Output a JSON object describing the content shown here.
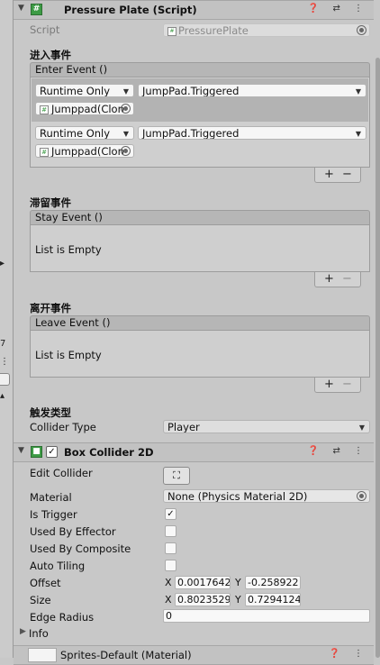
{
  "left_strip": {
    "mark_1": "▸",
    "mark_2": "7",
    "mark_3": "⋮",
    "mark_4": "▴"
  },
  "pressure_plate": {
    "title": "Pressure Plate (Script)",
    "header_icons": "❓ ⇄ ⋮",
    "script_label": "Script",
    "script_value": "PressurePlate",
    "enter": {
      "section_label": "进入事件",
      "header": "Enter Event ()",
      "rows": [
        {
          "mode": "Runtime Only",
          "function": "JumpPad.Triggered",
          "target": "Jumppad(Clon"
        },
        {
          "mode": "Runtime Only",
          "function": "JumpPad.Triggered",
          "target": "Jumppad(Clon"
        }
      ]
    },
    "stay": {
      "section_label": "滞留事件",
      "header": "Stay Event ()",
      "empty_text": "List is Empty"
    },
    "leave": {
      "section_label": "离开事件",
      "header": "Leave Event ()",
      "empty_text": "List is Empty"
    },
    "trigger": {
      "section_label": "触发类型",
      "collider_type_label": "Collider Type",
      "collider_type_value": "Player"
    },
    "plus": "+",
    "minus": "−"
  },
  "box_collider": {
    "title": "Box Collider 2D",
    "header_icons": "❓ ⇄ ⋮",
    "enabled": true,
    "edit_collider_label": "Edit Collider",
    "edit_collider_icon": "⛶",
    "material_label": "Material",
    "material_value": "None (Physics Material 2D)",
    "is_trigger_label": "Is Trigger",
    "is_trigger": true,
    "used_by_effector_label": "Used By Effector",
    "used_by_composite_label": "Used By Composite",
    "auto_tiling_label": "Auto Tiling",
    "offset_label": "Offset",
    "offset_x": "0.0017642",
    "offset_y": "-0.258922",
    "size_label": "Size",
    "size_x": "0.8023529",
    "size_y": "0.7294124",
    "edge_radius_label": "Edge Radius",
    "edge_radius_value": "0",
    "info_label": "Info",
    "x_label": "X",
    "y_label": "Y",
    "check_mark": "✓"
  },
  "material_component": {
    "title": "Sprites-Default (Material)",
    "header_icons": "❓ ⋮"
  },
  "colors": {
    "panel_bg": "#c8c8c8",
    "script_icon_green": "#3d9b45",
    "event_header_bg": "#b6b6b6"
  }
}
